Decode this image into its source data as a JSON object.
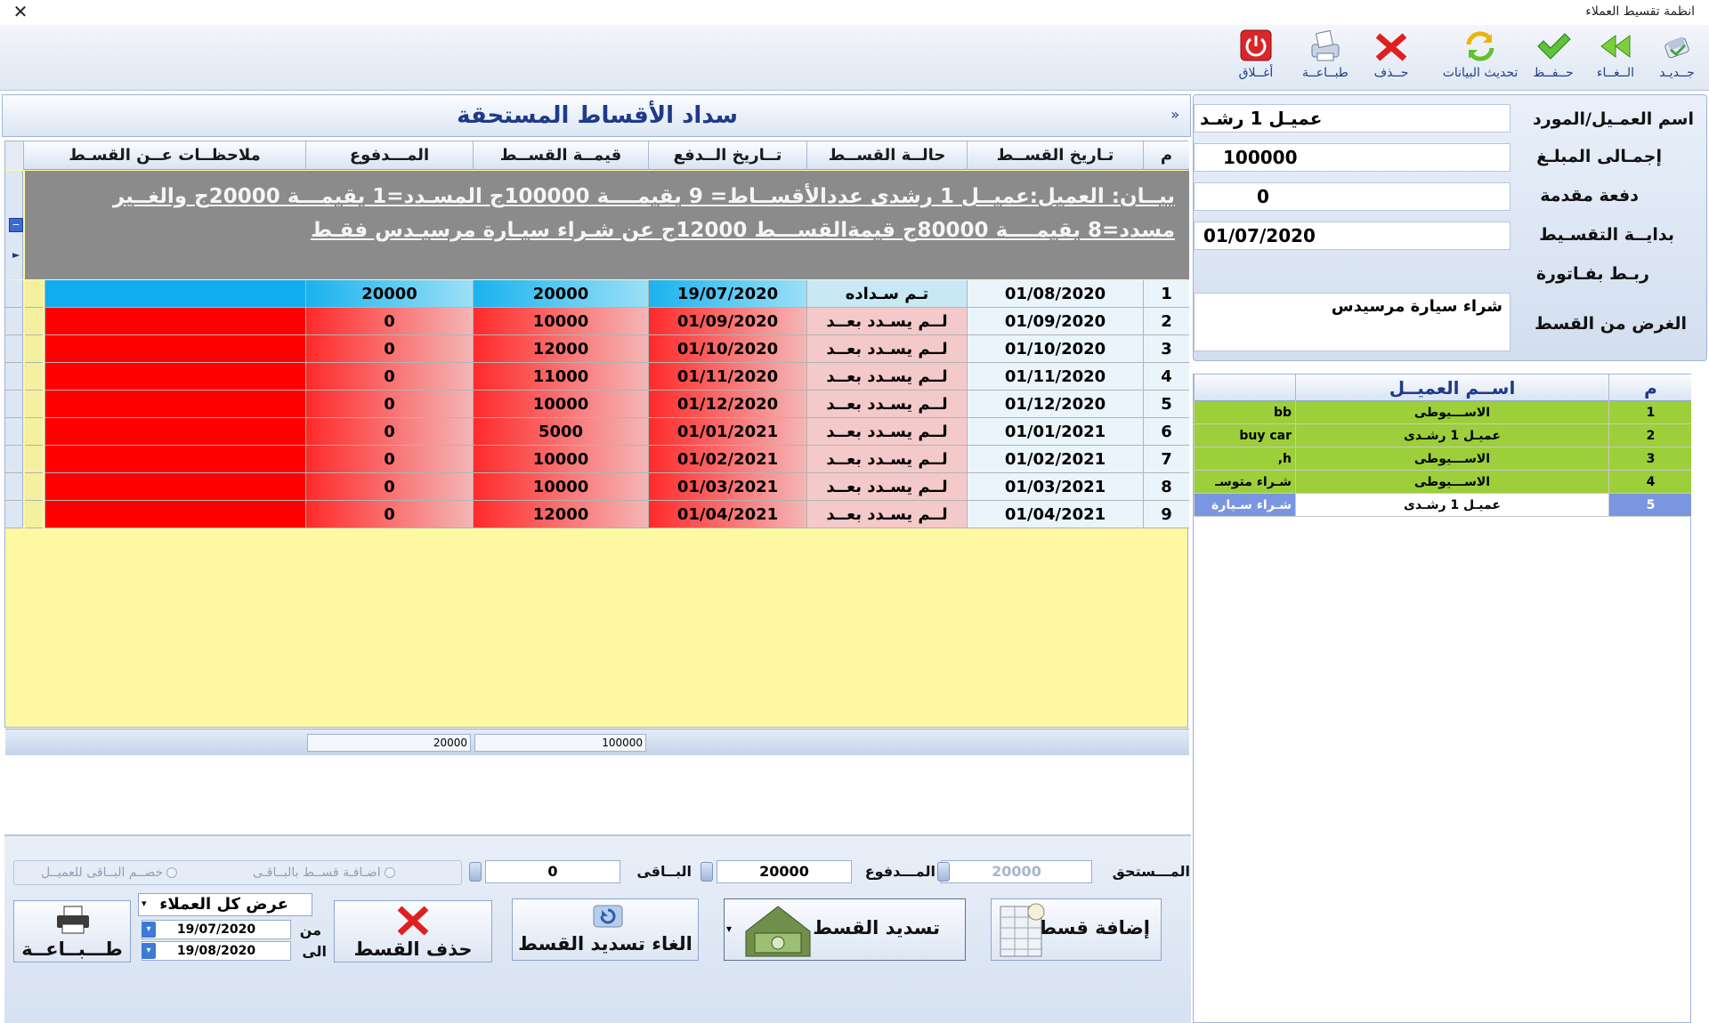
{
  "window": {
    "title": "انظمة تقسيط العملاء",
    "close": "✕"
  },
  "toolbar": {
    "new": "جــديـد",
    "cancel": "الــغــاء",
    "save": "حــفــظ",
    "refresh": "تحديث البيانات",
    "delete": "حــذف",
    "print": "طبــاعــة",
    "close": "أغــلاق"
  },
  "main": {
    "title": "سداد الأقساط المستحقة",
    "collapse": "»"
  },
  "grid": {
    "headers": [
      "م",
      "تـاريخ القســط",
      "حالــة القســط",
      "تــاريخ الــدفع",
      "قيمــة القســط",
      "المـــدفوع",
      "ملاحظــات عــن القسـط"
    ],
    "group_text": "بيــان: العميل:عميــل 1 رشدى عددالأقســاط= 9 بقيمــــة 100000ج المسـدد=1 بقيمـــة 20000ج والغــير مسدد=8 بقيمــــة 80000ج قيمةالقســـط 12000ج عن شـراء سيـارة مرسيـدس فقـط",
    "rows": [
      {
        "n": "1",
        "date": "01/08/2020",
        "status": "تـم سـداده",
        "paid_date": "19/07/2020",
        "value": "20000",
        "paid": "20000",
        "notes": ""
      },
      {
        "n": "2",
        "date": "01/09/2020",
        "status": "لــم يسـدد بعــد",
        "paid_date": "01/09/2020",
        "value": "10000",
        "paid": "0",
        "notes": ""
      },
      {
        "n": "3",
        "date": "01/10/2020",
        "status": "لــم يسـدد بعــد",
        "paid_date": "01/10/2020",
        "value": "12000",
        "paid": "0",
        "notes": ""
      },
      {
        "n": "4",
        "date": "01/11/2020",
        "status": "لــم يسـدد بعــد",
        "paid_date": "01/11/2020",
        "value": "11000",
        "paid": "0",
        "notes": ""
      },
      {
        "n": "5",
        "date": "01/12/2020",
        "status": "لــم يسـدد بعــد",
        "paid_date": "01/12/2020",
        "value": "10000",
        "paid": "0",
        "notes": ""
      },
      {
        "n": "6",
        "date": "01/01/2021",
        "status": "لــم يسـدد بعــد",
        "paid_date": "01/01/2021",
        "value": "5000",
        "paid": "0",
        "notes": ""
      },
      {
        "n": "7",
        "date": "01/02/2021",
        "status": "لــم يسـدد بعــد",
        "paid_date": "01/02/2021",
        "value": "10000",
        "paid": "0",
        "notes": ""
      },
      {
        "n": "8",
        "date": "01/03/2021",
        "status": "لــم يسـدد بعــد",
        "paid_date": "01/03/2021",
        "value": "10000",
        "paid": "0",
        "notes": ""
      },
      {
        "n": "9",
        "date": "01/04/2021",
        "status": "لــم يسـدد بعــد",
        "paid_date": "01/04/2021",
        "value": "12000",
        "paid": "0",
        "notes": ""
      }
    ],
    "footer_value_total": "100000",
    "footer_paid_total": "20000"
  },
  "payment": {
    "due_label": "المـــستحق",
    "due_value": "20000",
    "paid_label": "المـــدفوع",
    "paid_value": "20000",
    "remain_label": "البــاقى",
    "remain_value": "0",
    "radio_add": "اضـافـة قســط بالبــاقـى",
    "radio_deduct": "خصــم البــاقى للعميــل"
  },
  "buttons": {
    "add_installment": "إضافة قسط",
    "pay_installment": "تسديد القسط",
    "cancel_payment": "الغاء تسديد القسط",
    "delete_installment": "حذف القسط",
    "print": "طـــبــاعــة"
  },
  "filter": {
    "select_value": "عرض كل العملاء",
    "from_label": "من",
    "from_date": "19/07/2020",
    "to_label": "الى",
    "to_date": "19/08/2020"
  },
  "customer": {
    "name_label": "اسم العمـيل/المورد",
    "name_value": "عميـل 1 رشـد",
    "total_label": "إجمـالى المبلـغ",
    "total_value": "100000",
    "down_label": "دفعة مقدمة",
    "down_value": "0",
    "start_label": "بدايــة التقسـيط",
    "start_value": "01/07/2020",
    "invoice_label": "ربـط بفـاتورة",
    "purpose_label": "الغرض من القسط",
    "purpose_value": "شراء سيارة مرسيدس"
  },
  "customers_grid": {
    "headers": [
      "م",
      "اســم العميــل"
    ],
    "rows": [
      {
        "n": "1",
        "name": "الاســـيوطى",
        "note": "bb"
      },
      {
        "n": "2",
        "name": "عميـل 1 رشـدى",
        "note": "buy car"
      },
      {
        "n": "3",
        "name": "الاســـيوطى",
        "note": "h,"
      },
      {
        "n": "4",
        "name": "الاســـيوطى",
        "note": "شـراء متوسـ"
      },
      {
        "n": "5",
        "name": "عميـل 1 رشـدى",
        "note": "شـراء سـيارة"
      }
    ]
  },
  "colors": {
    "paid_row": "#5ccbf2",
    "unpaid_row": "#ff2a2a",
    "customer_row": "#9ccf3a",
    "selected_customer": "#7b96e0"
  }
}
